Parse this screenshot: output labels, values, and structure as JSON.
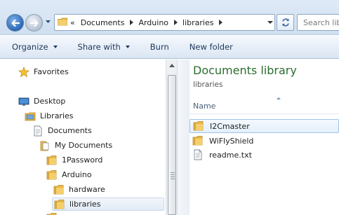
{
  "addressbar": {
    "overflow_marker": "«",
    "breadcrumbs": [
      "Documents",
      "Arduino",
      "libraries"
    ],
    "search_placeholder": "Search libraries"
  },
  "toolbar": {
    "organize": "Organize",
    "share_with": "Share with",
    "burn": "Burn",
    "new_folder": "New folder"
  },
  "navpane": {
    "favorites": "Favorites",
    "desktop": "Desktop",
    "libraries": "Libraries",
    "documents": "Documents",
    "my_documents": "My Documents",
    "onepassword": "1Password",
    "arduino": "Arduino",
    "hardware": "hardware",
    "libraries_folder": "libraries"
  },
  "content": {
    "title": "Documents library",
    "subtitle": "libraries",
    "column_name": "Name",
    "files": [
      {
        "name": "I2Cmaster",
        "type": "folder",
        "selected": true
      },
      {
        "name": "WiFlyShield",
        "type": "folder",
        "selected": false
      },
      {
        "name": "readme.txt",
        "type": "text",
        "selected": false
      }
    ]
  },
  "colors": {
    "folder": "#e8b84a",
    "title_green": "#2a6d2f",
    "toolbar_text": "#1e395b"
  }
}
